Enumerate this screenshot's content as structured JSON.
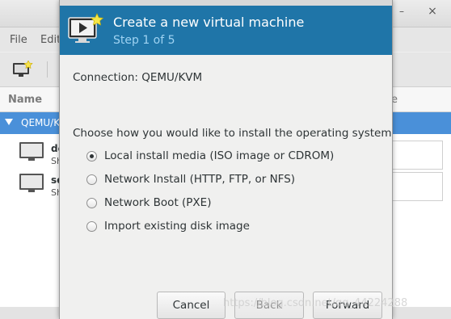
{
  "background_window": {
    "menu": {
      "file": "File",
      "edit": "Edit"
    },
    "list": {
      "name_header": "Name",
      "right_header": "e",
      "connection_label": "QEMU/KVM",
      "vms": [
        {
          "name": "de",
          "state": "Sh"
        },
        {
          "name": "se",
          "state": "Sh"
        }
      ]
    },
    "window_buttons": {
      "minimize": "–",
      "close": "×"
    }
  },
  "dialog": {
    "title": "Create a new virtual machine",
    "step": "Step 1 of 5",
    "connection": "Connection:  QEMU/KVM",
    "install_heading": "Choose how you would like to install the operating system",
    "options": [
      {
        "label": "Local install media (ISO image or CDROM)",
        "selected": true
      },
      {
        "label": "Network Install (HTTP, FTP, or NFS)",
        "selected": false
      },
      {
        "label": "Network Boot (PXE)",
        "selected": false
      },
      {
        "label": "Import existing disk image",
        "selected": false
      }
    ],
    "buttons": {
      "cancel": "Cancel",
      "back": "Back",
      "forward": "Forward"
    }
  },
  "watermark": "https://blog.csdn.net/qq_44224288",
  "colors": {
    "header_bg": "#1f75a8",
    "step_text": "#9fd3f2",
    "selection_bg": "#4a90d9"
  }
}
